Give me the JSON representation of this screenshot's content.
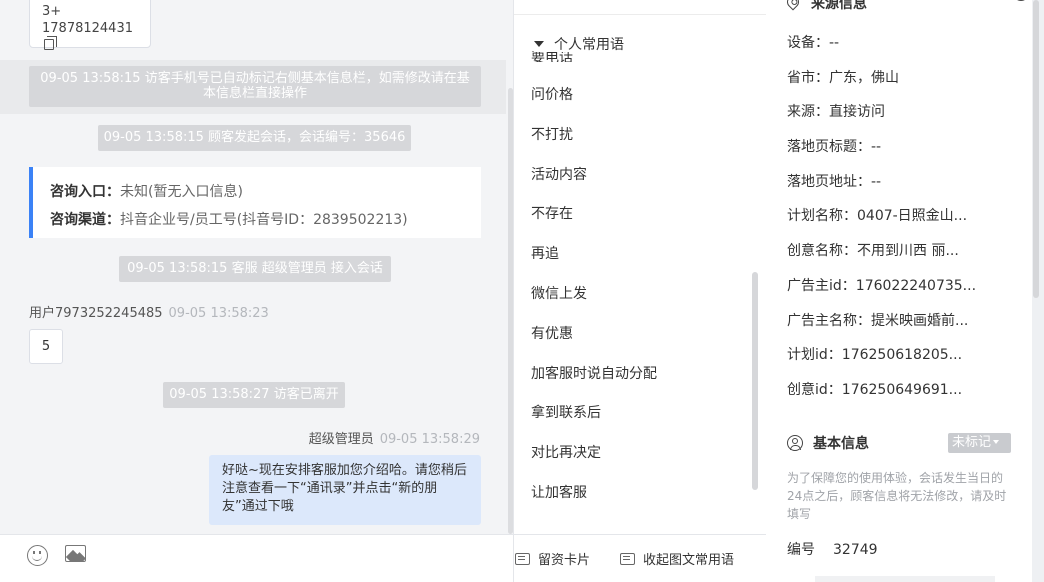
{
  "chat": {
    "phone_card": {
      "line1": "3+",
      "line2": "17878124431"
    },
    "top_links": [
      "",
      ""
    ],
    "system_messages": [
      "09-05 13:58:15 访客手机号已自动标记右侧基本信息栏，如需修改请在基本信息栏直接操作",
      "09-05 13:58:15 顾客发起会话，会话编号：35646",
      "09-05 13:58:15 客服 超级管理员 接入会话",
      "09-05 13:58:27 访客已离开"
    ],
    "consult": {
      "entry_label": "咨询入口：",
      "entry_value": "未知(暂无入口信息)",
      "channel_label": "咨询渠道：",
      "channel_value": "抖音企业号/员工号(抖音号ID：2839502213)"
    },
    "user_message": {
      "sender": "用户7973252245485",
      "time": "09-05 13:58:23",
      "text": "5"
    },
    "agent_message": {
      "sender": "超级管理员",
      "time": "09-05 13:58:29",
      "text": "好哒~现在安排客服加您介绍哈。请您稍后注意查看一下“通讯录”并点击“新的朋友”通过下哦"
    },
    "toolbar": {
      "emoji_icon": "emoji-icon",
      "image_icon": "image-icon"
    }
  },
  "phrases": {
    "group_label": "个人常用语",
    "cut_item": "要电话",
    "items": [
      "问价格",
      "不打扰",
      "活动内容",
      "不存在",
      "再追",
      "微信上发",
      "有优惠",
      "加客服时说自动分配",
      "拿到联系后",
      "对比再决定",
      "让加客服"
    ],
    "bottom": {
      "card_button": "留资卡片",
      "collapse_button": "收起图文常用语"
    }
  },
  "info": {
    "source_title": "来源信息",
    "source_rows": [
      {
        "k": "设备：",
        "v": "--"
      },
      {
        "k": "省市：",
        "v": "广东，佛山"
      },
      {
        "k": "来源：",
        "v": "直接访问"
      },
      {
        "k": "落地页标题：",
        "v": "--"
      },
      {
        "k": "落地页地址：",
        "v": "--"
      },
      {
        "k": "计划名称：",
        "v": "0407-日照金山..."
      },
      {
        "k": "创意名称：",
        "v": "不用到川西 丽..."
      },
      {
        "k": "广告主id：",
        "v": "176022240735..."
      },
      {
        "k": "广告主名称：",
        "v": "提米映画婚前..."
      },
      {
        "k": "计划id：",
        "v": "176250618205..."
      },
      {
        "k": "创意id：",
        "v": "176250649691..."
      }
    ],
    "basic_title": "基本信息",
    "tag_label": "未标记",
    "notice": "为了保障您的使用体验，会话发生当日的24点之后，顾客信息将无法修改，请及时填写",
    "id_label": "编号",
    "id_value": "32749"
  }
}
